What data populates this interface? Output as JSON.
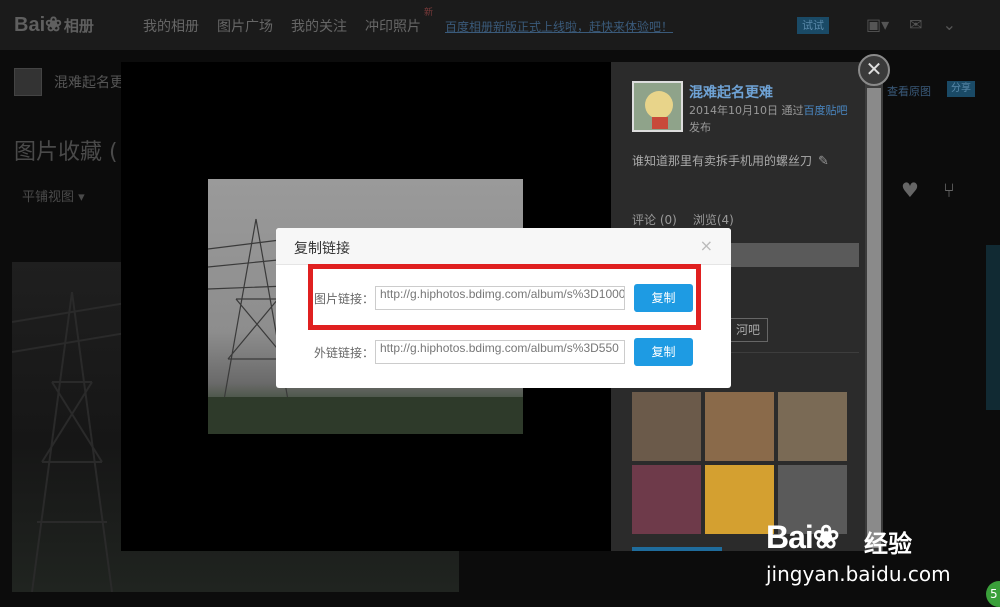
{
  "topbar": {
    "logo": "Bai",
    "logo_suffix": "相册",
    "nav": [
      "我的相册",
      "图片广场",
      "我的关注",
      "冲印照片"
    ],
    "nav_badge": "新",
    "promo_text": "百度相册新版正式上线啦，赶快来体验吧！",
    "promo_button": "试试"
  },
  "background": {
    "user_name": "混难起名更难",
    "page_title": "图片收藏 (",
    "view_toggle": "平铺视图 ▾",
    "right_link": "查看原图",
    "right_button": "分享"
  },
  "viewer": {
    "author_name": "混难起名更难",
    "post_date": "2014年10月10日 通过",
    "post_source": "百度贴吧",
    "post_verb": "发布",
    "description": "谁知道那里有卖拆手机用的螺丝刀",
    "comments": "评论 (0)",
    "views": "浏览(4)",
    "tieba_button": "河吧",
    "close_glyph": "✕"
  },
  "dialog": {
    "title": "复制链接",
    "close_glyph": "×",
    "rows": [
      {
        "label": "图片链接：",
        "value": "http://g.hiphotos.bdimg.com/album/s%3D1000",
        "button": "复制"
      },
      {
        "label": "外链链接：",
        "value": "http://g.hiphotos.bdimg.com/album/s%3D550",
        "button": "复制"
      }
    ]
  },
  "related_thumbs": [
    {
      "color": "#6b5a4a"
    },
    {
      "color": "#8a6a4a"
    },
    {
      "color": "#7a6a55"
    },
    {
      "color": "#6e3a4a"
    },
    {
      "color": "#d4a030"
    },
    {
      "color": "#5a5a5a"
    }
  ],
  "watermark": {
    "brand": "Bai",
    "brand_tail": "经验",
    "url": "jingyan.baidu.com"
  },
  "corner_badge": "5",
  "colors": {
    "accent_blue": "#1e9be3",
    "highlight_red": "#e02020",
    "link_blue": "#6fa3d6"
  }
}
